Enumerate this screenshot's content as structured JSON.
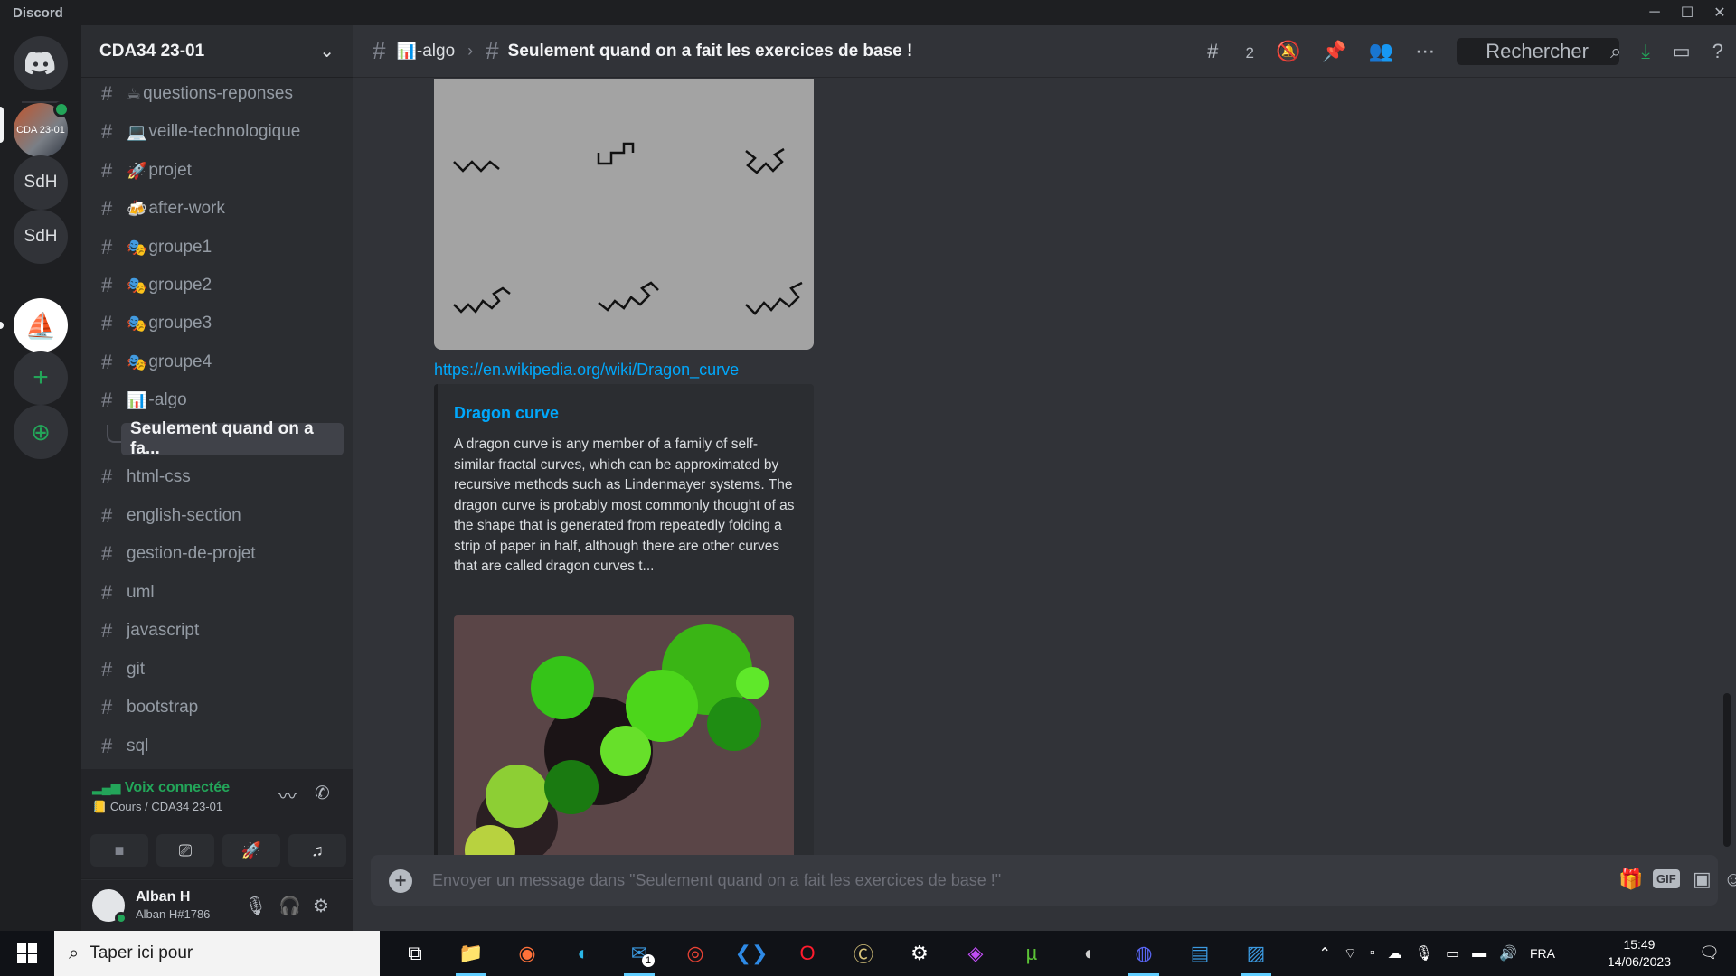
{
  "app_title": "Discord",
  "window_controls": {
    "minimize": "─",
    "maximize": "☐",
    "close": "✕"
  },
  "servers": [
    {
      "label": "CDA 23-01"
    },
    {
      "label": "SdH"
    },
    {
      "label": "SdH"
    },
    {
      "label": "⛵"
    },
    {
      "label": "+"
    },
    {
      "label": "⊕"
    }
  ],
  "guild": {
    "name": "CDA34 23-01",
    "menu_icon": "⌄"
  },
  "channels": [
    {
      "emoji": "☕",
      "name": "questions-reponses"
    },
    {
      "emoji": "💻",
      "name": "veille-technologique"
    },
    {
      "emoji": "🚀",
      "name": "projet"
    },
    {
      "emoji": "🍻",
      "name": "after-work"
    },
    {
      "emoji": "🎭",
      "name": "groupe1"
    },
    {
      "emoji": "🎭",
      "name": "groupe2"
    },
    {
      "emoji": "🎭",
      "name": "groupe3"
    },
    {
      "emoji": "🎭",
      "name": "groupe4"
    },
    {
      "emoji": "📊",
      "name": "-algo"
    },
    {
      "emoji": "",
      "name": "Seulement quand on a fa..."
    },
    {
      "emoji": "",
      "name": "html-css"
    },
    {
      "emoji": "",
      "name": "english-section"
    },
    {
      "emoji": "",
      "name": "gestion-de-projet"
    },
    {
      "emoji": "",
      "name": "uml"
    },
    {
      "emoji": "",
      "name": "javascript"
    },
    {
      "emoji": "",
      "name": "git"
    },
    {
      "emoji": "",
      "name": "bootstrap"
    },
    {
      "emoji": "",
      "name": "sql"
    }
  ],
  "voice": {
    "status": "Voix connectée",
    "location": "Cours / CDA34 23-01"
  },
  "user": {
    "name": "Alban H",
    "tag": "Alban H#1786"
  },
  "topbar": {
    "channel": "-algo",
    "channel_emoji": "📊",
    "thread": "Seulement quand on a fait les exercices de base !",
    "threads_count": "2",
    "search_placeholder": "Rechercher"
  },
  "message": {
    "link": "https://en.wikipedia.org/wiki/Dragon_curve",
    "embed_title": "Dragon curve",
    "embed_description": "A dragon curve is any member of a family of self-similar fractal curves, which can be approximated by recursive methods such as Lindenmayer systems. The dragon curve is probably most commonly thought of as the shape that is generated from repeatedly folding a strip of paper in half, although there are other curves that are called dragon curves t..."
  },
  "input": {
    "placeholder": "Envoyer un message dans \"Seulement quand on a fait les exercices de base !\"",
    "gif_label": "GIF"
  },
  "taskbar": {
    "search_text": "Taper ici pour",
    "language": "FRA",
    "time": "15:49",
    "date": "14/06/2023",
    "mail_badge": "1"
  },
  "colors": {
    "accent": "#5865f2",
    "link": "#00a8fc",
    "online": "#23a559"
  }
}
